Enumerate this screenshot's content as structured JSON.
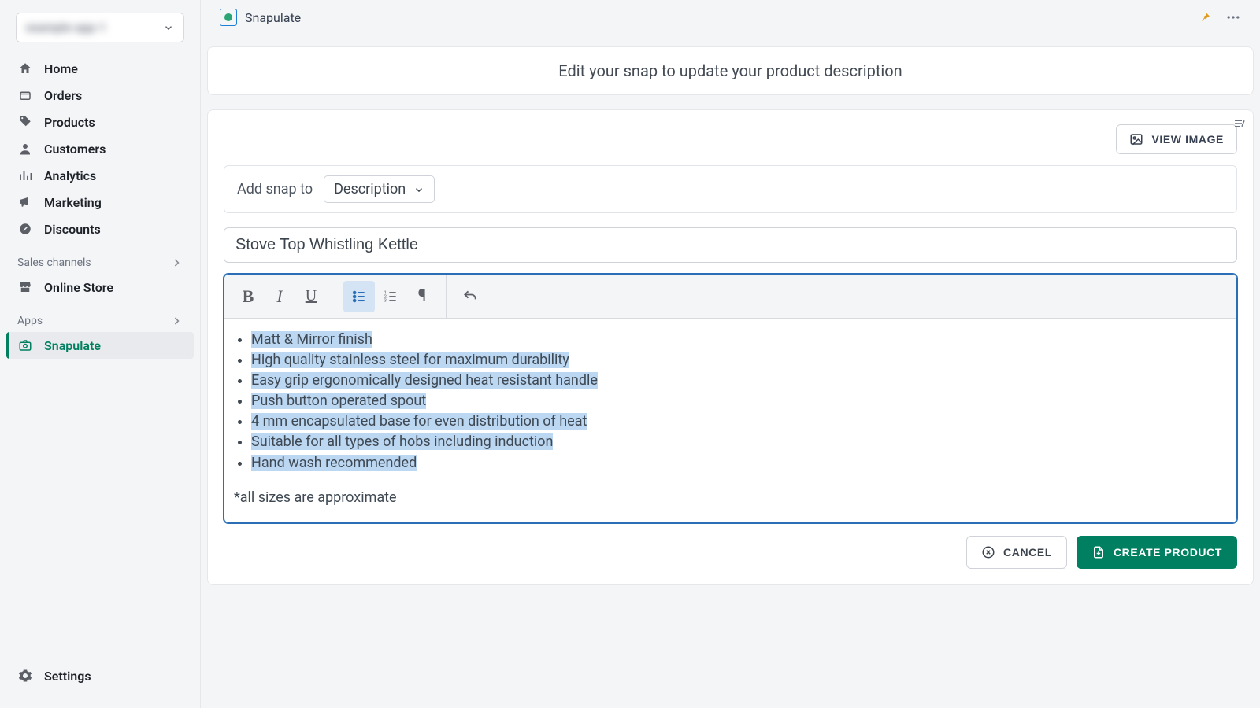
{
  "store_switcher": {
    "name": "example-app-1"
  },
  "nav": {
    "home": "Home",
    "orders": "Orders",
    "products": "Products",
    "customers": "Customers",
    "analytics": "Analytics",
    "marketing": "Marketing",
    "discounts": "Discounts"
  },
  "sections": {
    "sales_channels": "Sales channels",
    "online_store": "Online Store",
    "apps": "Apps",
    "snapulate": "Snapulate"
  },
  "settings": "Settings",
  "appbar": {
    "name": "Snapulate"
  },
  "hero": "Edit your snap to update your product description",
  "view_image": "VIEW IMAGE",
  "snapto": {
    "label": "Add snap to",
    "value": "Description"
  },
  "title": "Stove Top Whistling Kettle",
  "bullets": [
    "Matt & Mirror finish",
    "High quality stainless steel for maximum durability",
    "Easy grip ergonomically designed heat resistant handle",
    "Push button operated spout",
    "4 mm encapsulated base for even distribution of heat",
    "Suitable for all types of hobs including induction",
    "Hand wash recommended"
  ],
  "note": "*all sizes are approximate",
  "buttons": {
    "cancel": "CANCEL",
    "create": "CREATE PRODUCT"
  }
}
